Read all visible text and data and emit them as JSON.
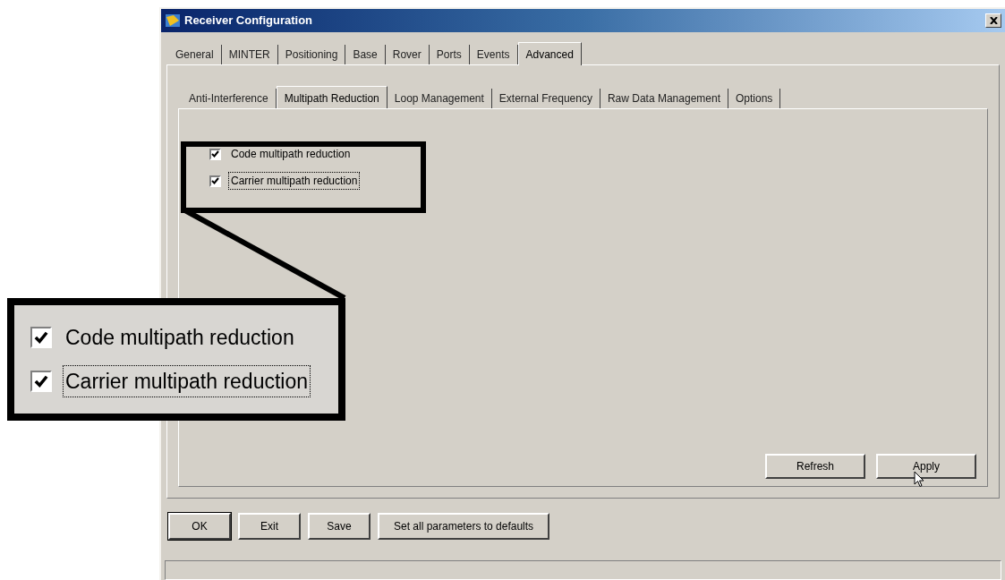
{
  "window": {
    "title": "Receiver Configuration"
  },
  "outer_tabs": [
    {
      "label": "General",
      "selected": false
    },
    {
      "label": "MINTER",
      "selected": false
    },
    {
      "label": "Positioning",
      "selected": false
    },
    {
      "label": "Base",
      "selected": false
    },
    {
      "label": "Rover",
      "selected": false
    },
    {
      "label": "Ports",
      "selected": false
    },
    {
      "label": "Events",
      "selected": false
    },
    {
      "label": "Advanced",
      "selected": true
    }
  ],
  "inner_tabs": [
    {
      "label": "Anti-Interference",
      "selected": false
    },
    {
      "label": "Multipath Reduction",
      "selected": true
    },
    {
      "label": "Loop Management",
      "selected": false
    },
    {
      "label": "External Frequency",
      "selected": false
    },
    {
      "label": "Raw Data Management",
      "selected": false
    },
    {
      "label": "Options",
      "selected": false
    }
  ],
  "options": [
    {
      "label": "Code multipath reduction",
      "checked": true,
      "focused": false
    },
    {
      "label": "Carrier multipath reduction",
      "checked": true,
      "focused": true
    }
  ],
  "callout": {
    "options": [
      {
        "label": "Code multipath reduction",
        "checked": true,
        "focused": false
      },
      {
        "label": "Carrier multipath reduction",
        "checked": true,
        "focused": true
      }
    ]
  },
  "panel_buttons": [
    "Refresh",
    "Apply"
  ],
  "dialog_buttons": [
    "OK",
    "Exit",
    "Save",
    "Set all parameters to defaults"
  ]
}
